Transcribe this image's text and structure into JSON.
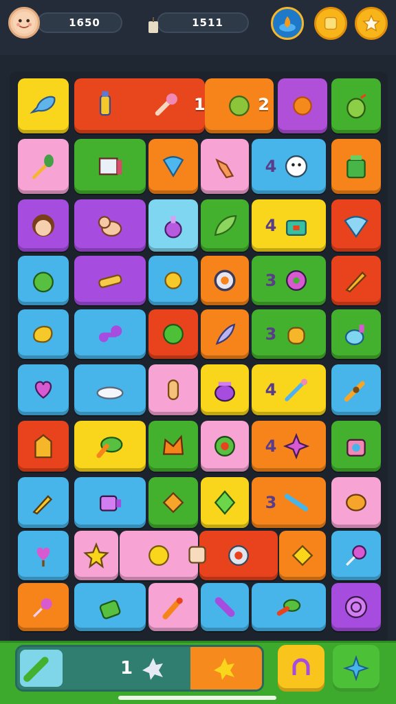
{
  "hud": {
    "score_left": "1650",
    "score_right": "1511"
  },
  "board_numbers": {
    "n_r1_a": "1",
    "n_r1_b": "2",
    "n_r2": "4",
    "n_r3": "4",
    "n_r4": "3",
    "n_r5": "3",
    "n_r6": "4",
    "n_r7": "4",
    "n_r8": "3"
  },
  "bottom": {
    "count": "1"
  },
  "colors": {
    "yellow": "#f9c51c",
    "orange": "#f7841a",
    "red": "#e8431c",
    "purple": "#a64de0",
    "green": "#43b02e",
    "pink": "#f7a3d4",
    "blue": "#47b5ea",
    "light_blue": "#7fd6f0"
  }
}
